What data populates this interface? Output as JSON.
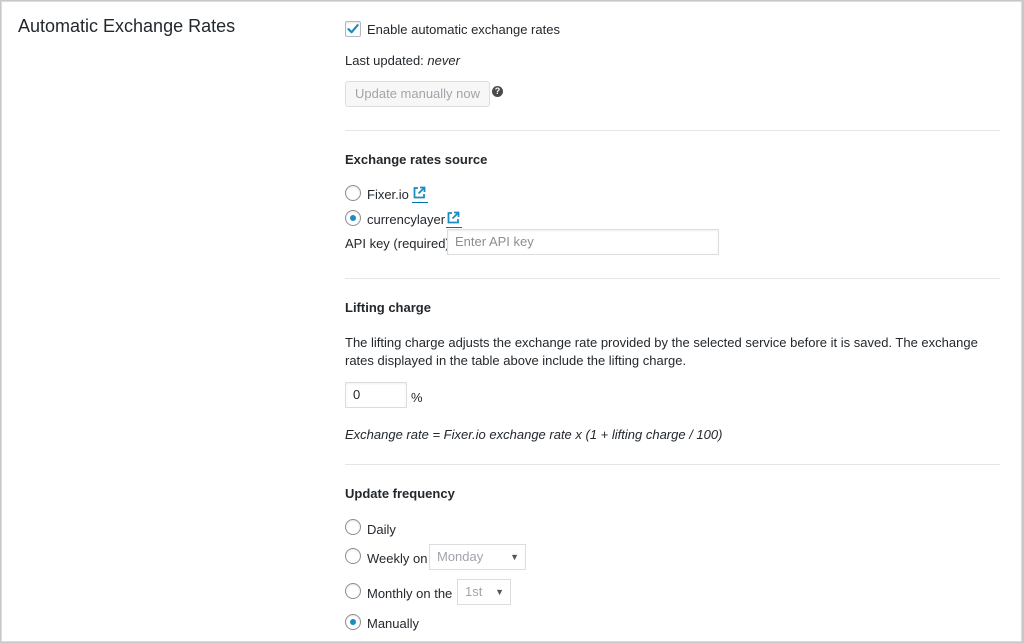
{
  "section": {
    "title": "Automatic Exchange Rates"
  },
  "auto": {
    "enable_label": "Enable automatic exchange rates",
    "enable_checked": true,
    "last_updated_label": "Last updated:",
    "last_updated_value": "never",
    "update_button": "Update manually now",
    "help_glyph": "?"
  },
  "source": {
    "heading": "Exchange rates source",
    "options": [
      {
        "label": "Fixer.io",
        "checked": false
      },
      {
        "label": "currencylayer",
        "checked": true
      }
    ],
    "api_key_label": "API key (required)",
    "api_key_placeholder": "Enter API key"
  },
  "lifting": {
    "heading": "Lifting charge",
    "description": "The lifting charge adjusts the exchange rate provided by the selected service before it is saved. The exchange rates displayed in the table above include the lifting charge.",
    "value": "0",
    "unit": "%",
    "formula": "Exchange rate = Fixer.io exchange rate x (1 + lifting charge / 100)"
  },
  "frequency": {
    "heading": "Update frequency",
    "daily_label": "Daily",
    "weekly_label": "Weekly on",
    "weekly_value": "Monday",
    "monthly_label": "Monthly on the",
    "monthly_value": "1st",
    "manual_label": "Manually",
    "selected": "Manually"
  },
  "colors": {
    "accent": "#1e8cbe",
    "link": "#0073aa",
    "text": "#23282d"
  },
  "icons": {
    "external": "external-link-icon",
    "help": "help-icon",
    "check": "checkmark-icon",
    "dropdown": "chevron-down-icon"
  }
}
